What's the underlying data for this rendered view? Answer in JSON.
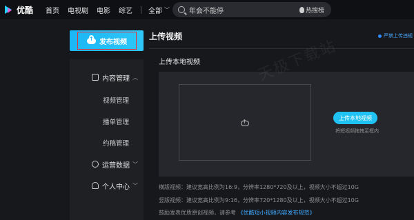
{
  "topbar": {
    "logo_text": "优酷",
    "nav": [
      "首页",
      "电视剧",
      "电影",
      "综艺"
    ],
    "all_label": "全部",
    "search_placeholder": "年会不能停",
    "hot_label": "热搜榜"
  },
  "sidebar": {
    "publish_label": "发布视频",
    "groups": [
      {
        "label": "内容管理",
        "items": [
          "视频管理",
          "播单管理",
          "约稿管理"
        ]
      },
      {
        "label": "运营数据",
        "items": []
      },
      {
        "label": "个人中心",
        "items": []
      }
    ]
  },
  "main": {
    "title": "上传视频",
    "notice": "严禁上传违规",
    "section_title": "上传本地视频",
    "upload_button": "上传本地视频",
    "drag_hint": "将短视频拖拽至框内",
    "watermark": "天极下载站",
    "info_lines": [
      "横版视频：建议宽高比例为16:9，分辨率1280*720及以上，视频大小不超过10G",
      "竖版视频：建议宽高比例为9:16，分辨率720*1280及以上，视频大小不超过10G"
    ],
    "policy_prefix": "鼓励发表优质原创视频，请参考",
    "policy_link": "《优酷短小视频内容发布规范》"
  },
  "colors": {
    "accent": "#1fc2f2",
    "highlight_border": "#e3343b",
    "link": "#3fa9ff",
    "background": "#17181c"
  }
}
